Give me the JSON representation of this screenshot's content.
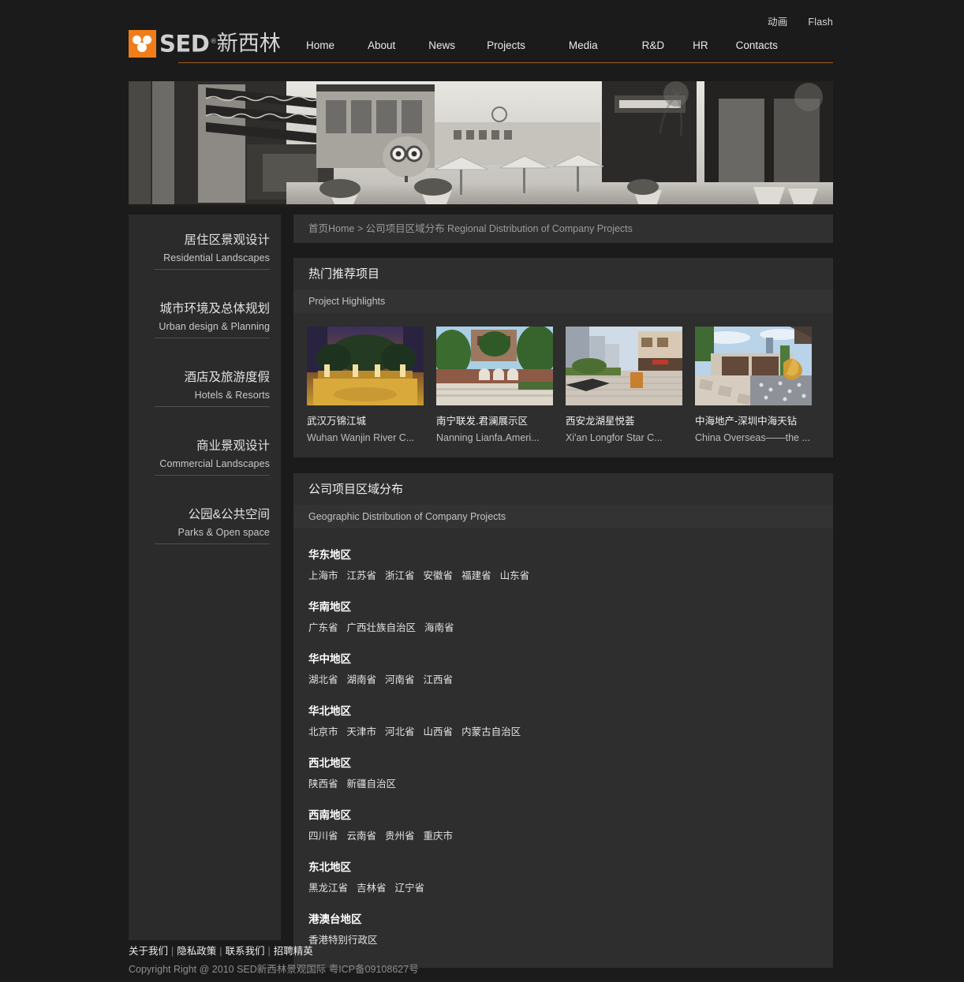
{
  "topbar": {
    "links": [
      {
        "label": "动画",
        "name": "animation-link"
      },
      {
        "label": "Flash",
        "name": "flash-link"
      }
    ]
  },
  "brand": {
    "mark_color": "#ef7d1a",
    "sed": "SED",
    "registered": "®",
    "cn": "新西林"
  },
  "nav": {
    "items": [
      {
        "label": "Home"
      },
      {
        "label": "About"
      },
      {
        "label": "News"
      },
      {
        "label": "Projects"
      },
      {
        "label": "Media"
      },
      {
        "label": "R&D"
      },
      {
        "label": "HR"
      },
      {
        "label": "Contacts"
      }
    ],
    "rule_color": "#a35e1e"
  },
  "sidebar": {
    "items": [
      {
        "cn": "居住区景观设计",
        "en": "Residential Landscapes"
      },
      {
        "cn": "城市环境及总体规划",
        "en": "Urban design & Planning"
      },
      {
        "cn": "酒店及旅游度假",
        "en": "Hotels & Resorts"
      },
      {
        "cn": "商业景观设计",
        "en": "Commercial Landscapes"
      },
      {
        "cn": "公园&公共空间",
        "en": "Parks & Open space"
      }
    ]
  },
  "breadcrumb": "首页Home > 公司项目区域分布 Regional Distribution of Company Projects",
  "highlights": {
    "title_cn": "热门推荐项目",
    "title_en": "Project Highlights",
    "projects": [
      {
        "cn": "武汉万锦江城",
        "en": "Wuhan Wanjin River C..."
      },
      {
        "cn": "南宁联发.君澜展示区",
        "en": "Nanning Lianfa.Ameri..."
      },
      {
        "cn": "西安龙湖星悦荟",
        "en": "Xi'an Longfor Star C..."
      },
      {
        "cn": "中海地产-深圳中海天钻",
        "en": "China Overseas——the ..."
      }
    ]
  },
  "distribution": {
    "title_cn": "公司项目区域分布",
    "title_en": "Geographic Distribution of Company Projects",
    "regions": [
      {
        "name": "华东地区",
        "provinces": [
          "上海市",
          "江苏省",
          "浙江省",
          "安徽省",
          "福建省",
          "山东省"
        ]
      },
      {
        "name": "华南地区",
        "provinces": [
          "广东省",
          "广西壮族自治区",
          "海南省"
        ]
      },
      {
        "name": "华中地区",
        "provinces": [
          "湖北省",
          "湖南省",
          "河南省",
          "江西省"
        ]
      },
      {
        "name": "华北地区",
        "provinces": [
          "北京市",
          "天津市",
          "河北省",
          "山西省",
          "内蒙古自治区"
        ]
      },
      {
        "name": "西北地区",
        "provinces": [
          "陕西省",
          "新疆自治区"
        ]
      },
      {
        "name": "西南地区",
        "provinces": [
          "四川省",
          "云南省",
          "贵州省",
          "重庆市"
        ]
      },
      {
        "name": "东北地区",
        "provinces": [
          "黑龙江省",
          "吉林省",
          "辽宁省"
        ]
      },
      {
        "name": "港澳台地区",
        "provinces": [
          "香港特别行政区"
        ]
      }
    ]
  },
  "footer": {
    "links": [
      "关于我们",
      "隐私政策",
      "联系我们",
      "招聘精英"
    ],
    "copyright": "Copyright Right @ 2010 SED新西林景观国际 粤ICP备09108627号"
  }
}
